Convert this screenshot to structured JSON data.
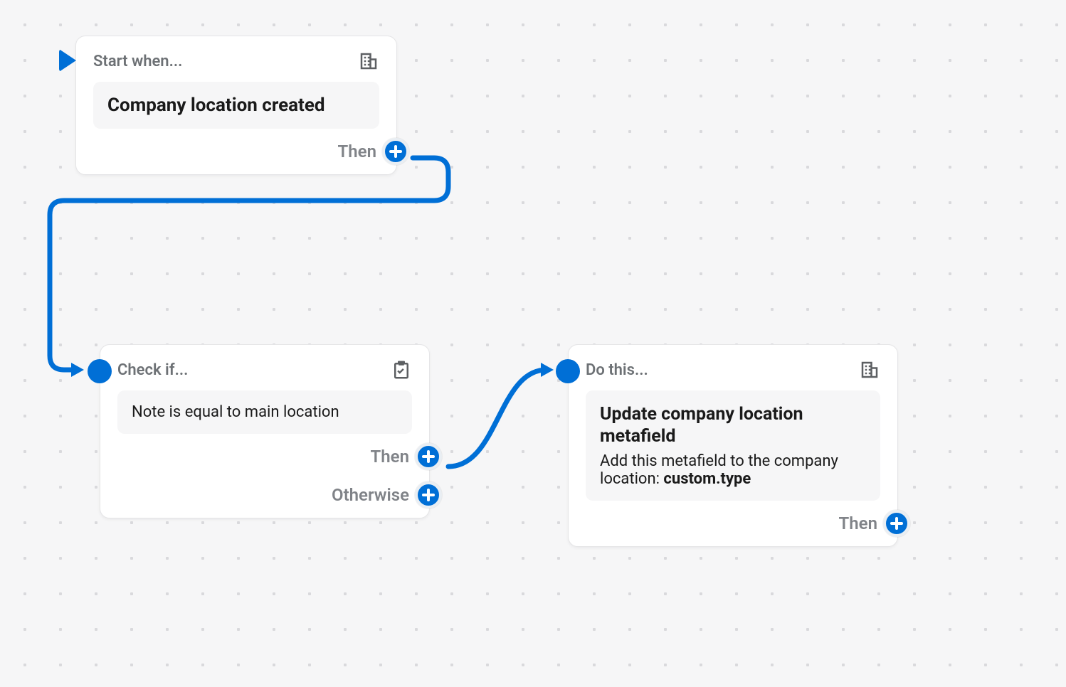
{
  "nodes": {
    "trigger": {
      "header_label": "Start when...",
      "title": "Company location created",
      "then_label": "Then"
    },
    "condition": {
      "header_label": "Check if...",
      "expression": "Note is equal to main location",
      "then_label": "Then",
      "otherwise_label": "Otherwise"
    },
    "action": {
      "header_label": "Do this...",
      "title": "Update company location metafield",
      "description_prefix": "Add this metafield to the company location: ",
      "description_bold": "custom.type",
      "then_label": "Then"
    }
  },
  "icons": {
    "building": "building-icon",
    "clipboard": "clipboard-check-icon",
    "play": "play-icon",
    "plus": "plus-icon"
  },
  "colors": {
    "accent": "#006fd6",
    "bg": "#f6f6f7",
    "muted": "#6d7175"
  }
}
